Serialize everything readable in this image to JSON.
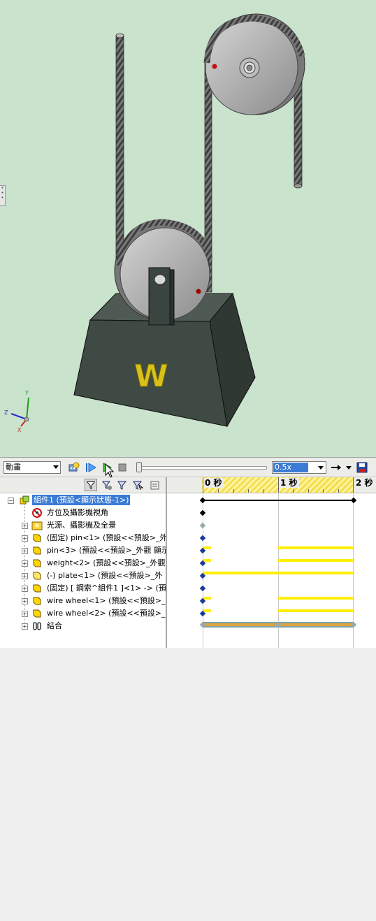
{
  "toolbar": {
    "study_type": "動畫",
    "playback_speed": "0.5x"
  },
  "timeline": {
    "marks": [
      "0 秒",
      "1 秒",
      "2 秒"
    ]
  },
  "tree": {
    "root": "組件1 (預設<顯示狀態-1>)",
    "items": [
      {
        "label": "方位及攝影機視角",
        "icon": "orientation-icon"
      },
      {
        "label": "光源、攝影機及全景",
        "icon": "lights-icon"
      },
      {
        "label": "(固定) pin<1> (預設<<預設>_外",
        "icon": "part-icon"
      },
      {
        "label": "pin<3> (預設<<預設>_外觀 顯示",
        "icon": "part-icon"
      },
      {
        "label": "weight<2> (預設<<預設>_外觀",
        "icon": "part-icon"
      },
      {
        "label": "(-) plate<1> (預設<<預設>_外",
        "icon": "part-icon"
      },
      {
        "label": "(固定) [ 鋼索^組件1 ]<1> -> (預",
        "icon": "part-icon"
      },
      {
        "label": "wire wheel<1> (預設<<預設>_",
        "icon": "part-icon"
      },
      {
        "label": "wire wheel<2> (預設<<預設>_",
        "icon": "part-icon"
      },
      {
        "label": "結合",
        "icon": "mates-icon"
      }
    ]
  },
  "viewport": {
    "letter": "W",
    "triad_labels": [
      "Y",
      "Z",
      "X"
    ]
  },
  "colors": {
    "viewport_bg": "#c9e3cd",
    "selection": "#3a7bd5",
    "timeline_bar": "#ffee00",
    "key_point": "#1a3a9c"
  }
}
